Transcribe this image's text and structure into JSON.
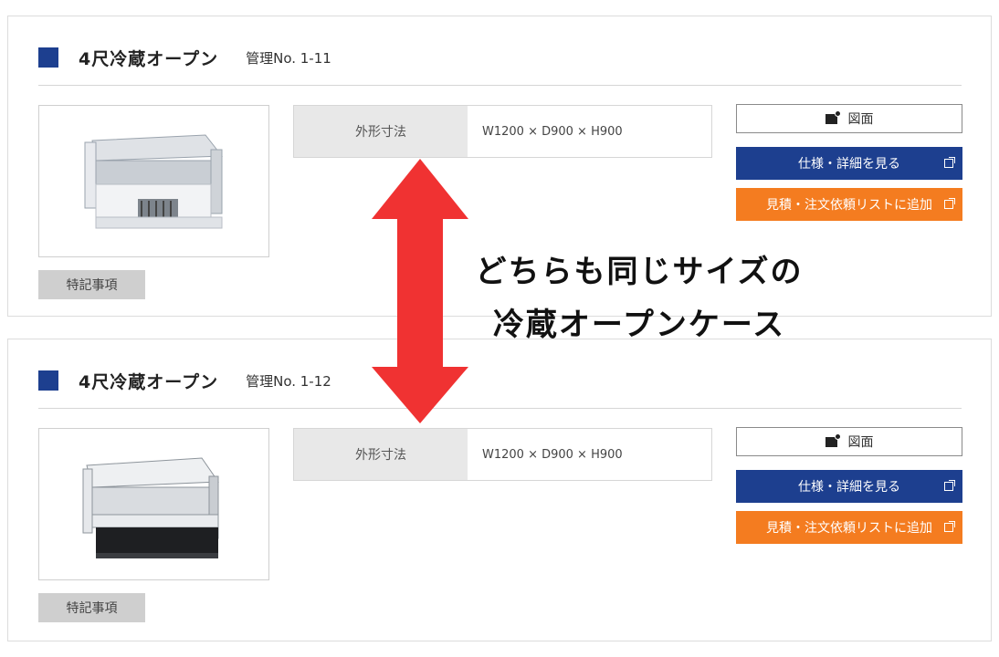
{
  "products": [
    {
      "title": "4尺冷蔵オープン",
      "management": "管理No.  1-11",
      "spec_label": "外形寸法",
      "spec_value": "W1200 × D900 × H900",
      "figure_button": "図面",
      "spec_button": "仕様・詳細を見る",
      "add_button": "見積・注文依頼リストに追加",
      "notes_button": "特記事項"
    },
    {
      "title": "4尺冷蔵オープン",
      "management": "管理No.  1-12",
      "spec_label": "外形寸法",
      "spec_value": "W1200 × D900 × H900",
      "figure_button": "図面",
      "spec_button": "仕様・詳細を見る",
      "add_button": "見積・注文依頼リストに追加",
      "notes_button": "特記事項"
    }
  ],
  "annotation": {
    "line1": "どちらも同じサイズの",
    "line2": "冷蔵オープンケース"
  },
  "colors": {
    "brand_blue": "#1d3f8f",
    "accent_orange": "#f47c20",
    "arrow_red": "#f03232"
  },
  "icons": {
    "figure": "drawing-icon",
    "external": "external-link-icon"
  }
}
